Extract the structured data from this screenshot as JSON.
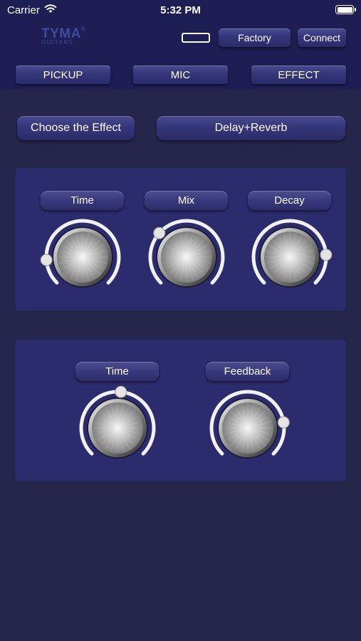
{
  "status_bar": {
    "carrier": "Carrier",
    "time": "5:32 PM"
  },
  "header": {
    "logo_main": "TYMA",
    "logo_registered": "®",
    "logo_sub": "GUITARS",
    "factory_label": "Factory",
    "connect_label": "Connect"
  },
  "tabs": [
    {
      "label": "PICKUP"
    },
    {
      "label": "MIC"
    },
    {
      "label": "EFFECT"
    }
  ],
  "effect": {
    "choose_label": "Choose the Effect",
    "selected": "Delay+Reverb"
  },
  "knobs": [
    {
      "label": "Time",
      "value": 0.15
    },
    {
      "label": "Mix",
      "value": 0.32
    },
    {
      "label": "Decay",
      "value": 0.82
    },
    {
      "label": "Time",
      "value": 0.52
    },
    {
      "label": "Feedback",
      "value": 0.8
    }
  ],
  "colors": {
    "background": "#26264d",
    "header": "#1e1e55",
    "panel": "#2b2b6e",
    "logo": "#3f4aa0",
    "ring": "#f2f2f2",
    "knob_track": "#2b2b6e"
  }
}
